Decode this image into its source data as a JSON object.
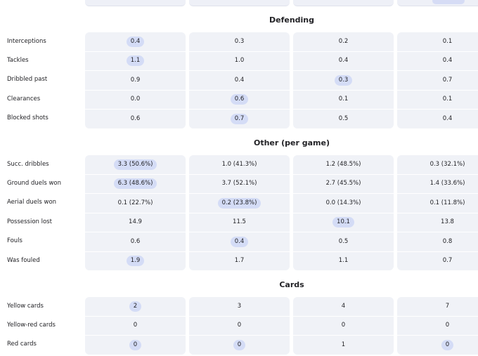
{
  "highlight_color": "#d4dcf6",
  "card_color": "#f0f2f7",
  "sections": [
    {
      "title": "Defending",
      "rows": [
        {
          "label": "Interceptions",
          "values": [
            "0.4",
            "0.3",
            "0.2",
            "0.1"
          ],
          "best": [
            0
          ]
        },
        {
          "label": "Tackles",
          "values": [
            "1.1",
            "1.0",
            "0.4",
            "0.4"
          ],
          "best": [
            0
          ]
        },
        {
          "label": "Dribbled past",
          "values": [
            "0.9",
            "0.4",
            "0.3",
            "0.7"
          ],
          "best": [
            2
          ]
        },
        {
          "label": "Clearances",
          "values": [
            "0.0",
            "0.6",
            "0.1",
            "0.1"
          ],
          "best": [
            1
          ]
        },
        {
          "label": "Blocked shots",
          "values": [
            "0.6",
            "0.7",
            "0.5",
            "0.4"
          ],
          "best": [
            1
          ]
        }
      ]
    },
    {
      "title": "Other (per game)",
      "rows": [
        {
          "label": "Succ. dribbles",
          "values": [
            "3.3 (50.6%)",
            "1.0 (41.3%)",
            "1.2 (48.5%)",
            "0.3 (32.1%)"
          ],
          "best": [
            0
          ]
        },
        {
          "label": "Ground duels won",
          "values": [
            "6.3 (48.6%)",
            "3.7 (52.1%)",
            "2.7 (45.5%)",
            "1.4 (33.6%)"
          ],
          "best": [
            0
          ]
        },
        {
          "label": "Aerial duels won",
          "values": [
            "0.1 (22.7%)",
            "0.2 (23.8%)",
            "0.0 (14.3%)",
            "0.1 (11.8%)"
          ],
          "best": [
            1
          ]
        },
        {
          "label": "Possession lost",
          "values": [
            "14.9",
            "11.5",
            "10.1",
            "13.8"
          ],
          "best": [
            2
          ]
        },
        {
          "label": "Fouls",
          "values": [
            "0.6",
            "0.4",
            "0.5",
            "0.8"
          ],
          "best": [
            1
          ]
        },
        {
          "label": "Was fouled",
          "values": [
            "1.9",
            "1.7",
            "1.1",
            "0.7"
          ],
          "best": [
            0
          ]
        }
      ]
    },
    {
      "title": "Cards",
      "rows": [
        {
          "label": "Yellow cards",
          "values": [
            "2",
            "3",
            "4",
            "7"
          ],
          "best": [
            0
          ]
        },
        {
          "label": "Yellow-red cards",
          "values": [
            "0",
            "0",
            "0",
            "0"
          ],
          "best": []
        },
        {
          "label": "Red cards",
          "values": [
            "0",
            "0",
            "1",
            "0"
          ],
          "best": [
            0,
            1,
            3
          ]
        }
      ]
    }
  ]
}
